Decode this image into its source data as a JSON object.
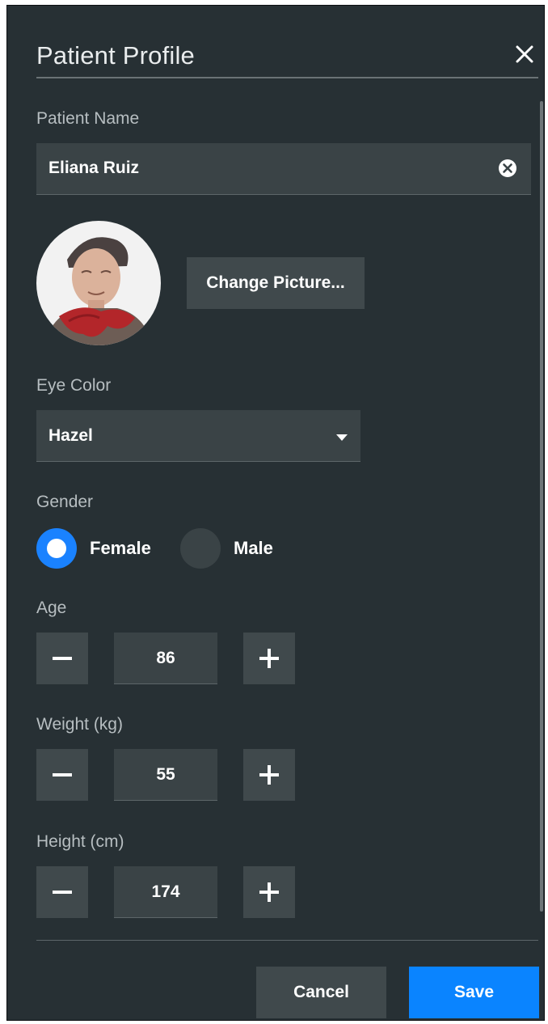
{
  "dialog": {
    "title": "Patient Profile",
    "close_icon": "close-icon"
  },
  "patient_name": {
    "label": "Patient Name",
    "value": "Eliana Ruiz",
    "clear_icon": "clear-circle-icon"
  },
  "picture": {
    "change_label": "Change Picture..."
  },
  "eye_color": {
    "label": "Eye Color",
    "selected": "Hazel",
    "caret_icon": "caret-down-icon"
  },
  "gender": {
    "label": "Gender",
    "options": [
      "Female",
      "Male"
    ],
    "selected": "Female",
    "accent_color": "#1a82ff"
  },
  "age": {
    "label": "Age",
    "value": "86"
  },
  "weight": {
    "label": "Weight (kg)",
    "value": "55"
  },
  "height": {
    "label": "Height (cm)",
    "value": "174"
  },
  "footer": {
    "cancel_label": "Cancel",
    "save_label": "Save",
    "save_color": "#0a84ff"
  }
}
